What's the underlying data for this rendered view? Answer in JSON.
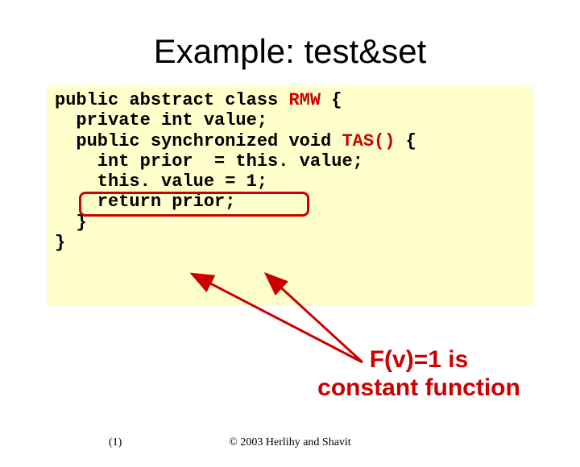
{
  "title": "Example: test&set",
  "code": {
    "l1a": "public abstract class ",
    "l1b": "RMW",
    "l1c": " {",
    "l2": "  private int value;",
    "l3": "",
    "l4a": "  public synchronized void ",
    "l4b": "TAS()",
    "l4c": " {",
    "l5": "    int prior  = this. value;",
    "l6": "    this. value = 1;",
    "l7": "    return prior;",
    "l8": "  }",
    "l9": "}"
  },
  "annotation": {
    "line1": "F(v)=1 is",
    "line2": "constant function"
  },
  "footer": {
    "page": "(1)",
    "copyright": "© 2003 Herlihy and Shavit"
  }
}
